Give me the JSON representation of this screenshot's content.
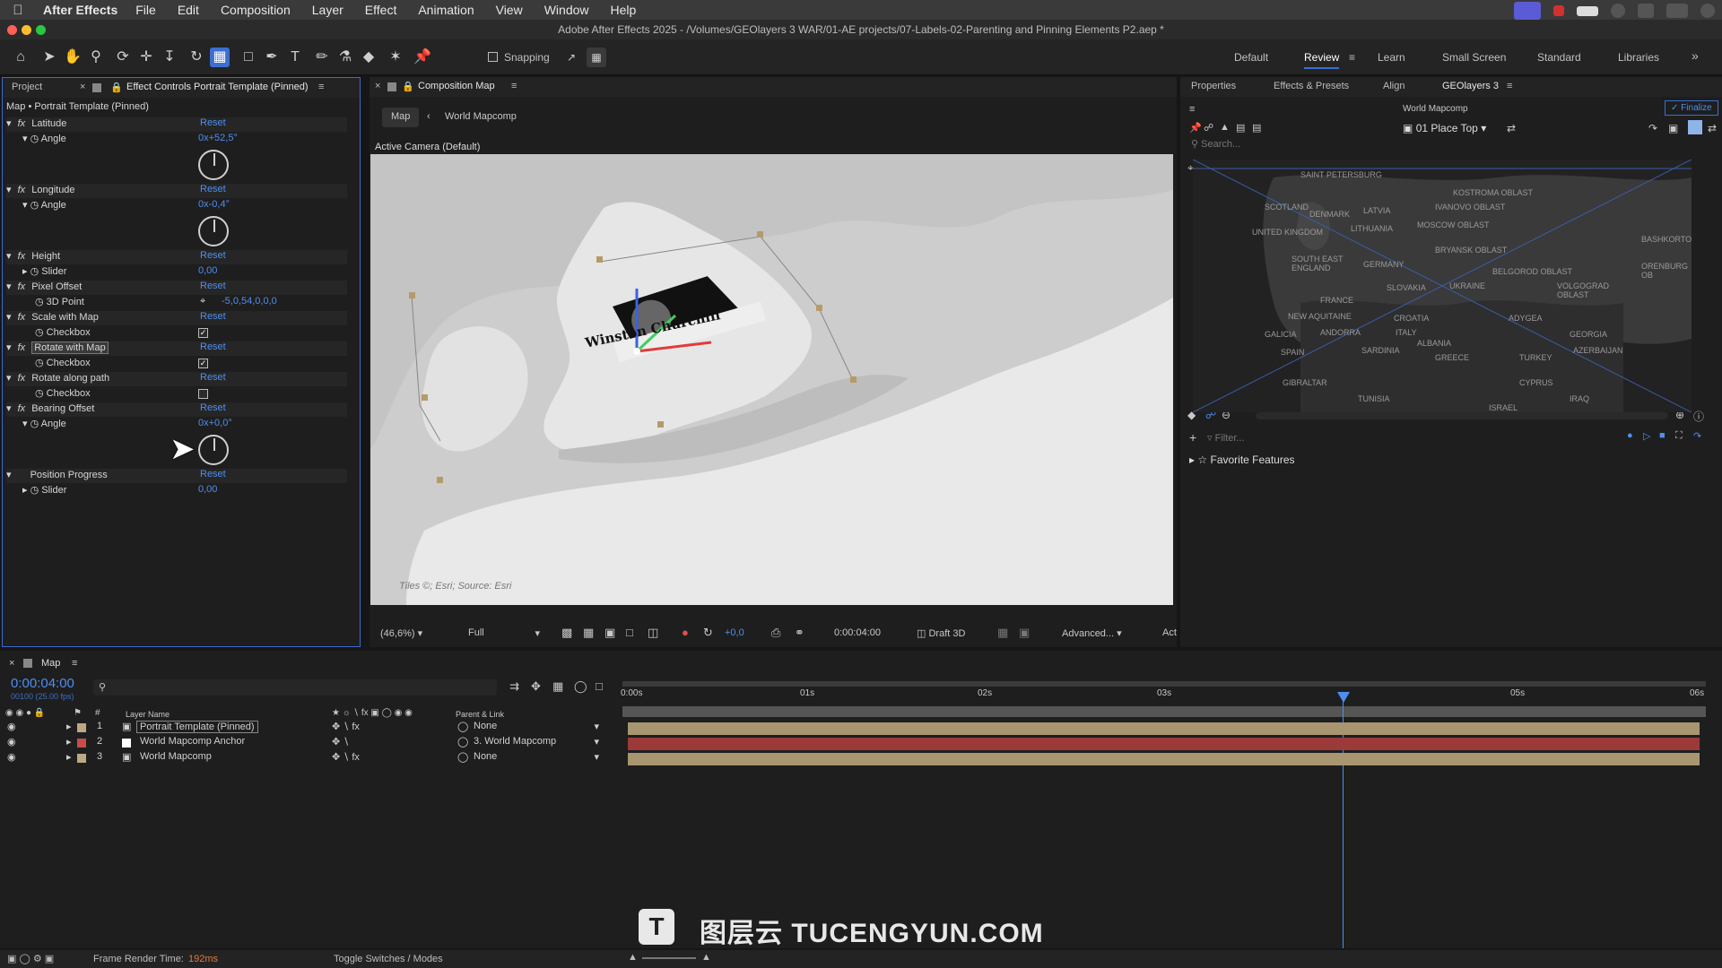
{
  "menubar": {
    "app": "After Effects",
    "items": [
      "File",
      "Edit",
      "Composition",
      "Layer",
      "Effect",
      "Animation",
      "View",
      "Window",
      "Help"
    ]
  },
  "window": {
    "title": "Adobe After Effects 2025 - /Volumes/GEOlayers 3 WAR/01-AE projects/07-Labels-02-Parenting and Pinning Elements P2.aep *"
  },
  "toolbar": {
    "snapping": "Snapping",
    "workspaces": [
      "Default",
      "Review",
      "Learn",
      "Small Screen",
      "Standard",
      "Libraries"
    ]
  },
  "left_panel": {
    "tab_project": "Project",
    "tab_effect": "Effect Controls Portrait Template (Pinned)",
    "path": "Map • Portrait Template (Pinned)",
    "reset": "Reset",
    "effects": [
      {
        "name": "Latitude",
        "prop": "Angle",
        "value": "0x+52,5°"
      },
      {
        "name": "Longitude",
        "prop": "Angle",
        "value": "0x-0,4°"
      },
      {
        "name": "Height",
        "prop": "Slider",
        "value": "0,00"
      },
      {
        "name": "Pixel Offset",
        "prop": "3D Point",
        "value": "-5,0,54,0,0,0"
      },
      {
        "name": "Scale with Map",
        "prop": "Checkbox"
      },
      {
        "name": "Rotate with Map",
        "prop": "Checkbox"
      },
      {
        "name": "Rotate along path",
        "prop": "Checkbox"
      },
      {
        "name": "Bearing Offset",
        "prop": "Angle",
        "value": "0x+0,0°"
      },
      {
        "name": "Position Progress",
        "prop": "Slider",
        "value": "0,00"
      }
    ]
  },
  "comp": {
    "tab": "Composition Map",
    "crumb_map": "Map",
    "crumb_world": "World Mapcomp",
    "camera": "Active Camera (Default)",
    "label": "Winston Churchill",
    "attribution": "Tiles ©; Esri; Source: Esri",
    "zoom": "(46,6%)",
    "resolution": "Full",
    "exposure": "+0,0",
    "timecode": "0:00:04:00",
    "renderer": "Draft 3D",
    "advanced": "Advanced...",
    "act": "Act"
  },
  "geo": {
    "tabs": [
      "Properties",
      "Effects & Presets",
      "Align",
      "GEOlayers 3"
    ],
    "finalize": "Finalize",
    "comp": "World Mapcomp",
    "style": "01 Place Top",
    "search": "Search...",
    "filter": "Filter...",
    "favorite": "Favorite Features",
    "places": [
      "SAINT PETERSBURG",
      "SCOTLAND",
      "LATVIA",
      "KOSTROMA OBLAST",
      "DENMARK",
      "IVANOVO OBLAST",
      "UNITED KINGDOM",
      "LITHUANIA",
      "MOSCOW OBLAST",
      "BASHKORTOST",
      "SOUTH EAST ENGLAND",
      "GERMANY",
      "BRYANSK OBLAST",
      "ORENBURG OB",
      "BELGOROD OBLAST",
      "SLOVAKIA",
      "UKRAINE",
      "VOLGOGRAD OBLAST",
      "FRANCE",
      "NEW AQUITAINE",
      "CROATIA",
      "ADYGEA",
      "ANDORRA",
      "ITALY",
      "GEORGIA",
      "GALICIA",
      "ALBANIA",
      "SPAIN",
      "SARDINIA",
      "AZERBAIJAN",
      "GREECE",
      "TURKEY",
      "GIBRALTAR",
      "CYPRUS",
      "TUNISIA",
      "IRAQ",
      "ISRAEL"
    ]
  },
  "timeline": {
    "comp": "Map",
    "timecode": "0:00:04:00",
    "fps": "00100 (25.00 fps)",
    "col_layer": "Layer Name",
    "col_parent": "Parent & Link",
    "ticks": [
      "0:00s",
      "01s",
      "02s",
      "03s",
      "05s",
      "06s"
    ],
    "layers": [
      {
        "num": "1",
        "name": "Portrait Template (Pinned)",
        "parent": "None"
      },
      {
        "num": "2",
        "name": "World Mapcomp Anchor",
        "parent": "3. World Mapcomp"
      },
      {
        "num": "3",
        "name": "World Mapcomp",
        "parent": "None"
      }
    ]
  },
  "status": {
    "render_label": "Frame Render Time:",
    "render_value": "192ms",
    "toggle": "Toggle Switches / Modes"
  },
  "watermark": {
    "text": "图层云 TUCENGYUN.COM"
  }
}
